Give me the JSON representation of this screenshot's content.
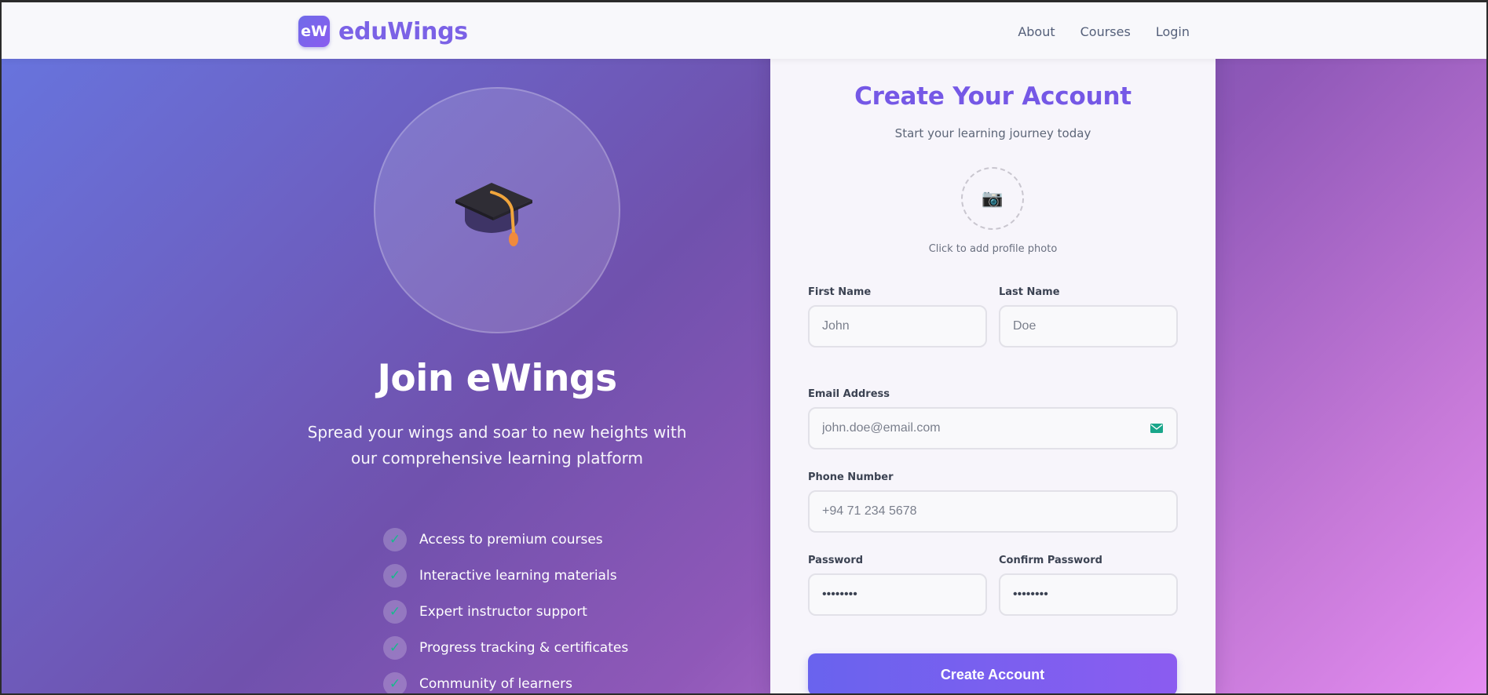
{
  "navbar": {
    "logo_mark": "eW",
    "brand_name": "eduWings",
    "links": [
      "About",
      "Courses",
      "Login"
    ]
  },
  "hero": {
    "title": "Join eWings",
    "subtitle": "Spread your wings and soar to new heights with our comprehensive learning platform",
    "features": [
      "Access to premium courses",
      "Interactive learning materials",
      "Expert instructor support",
      "Progress tracking & certificates",
      "Community of learners"
    ],
    "check_glyph": "✓"
  },
  "form": {
    "title": "Create Your Account",
    "subtitle": "Start your learning journey today",
    "photo_icon": "📷",
    "photo_hint": "Click to add profile photo",
    "first_name": {
      "label": "First Name",
      "placeholder": "John"
    },
    "last_name": {
      "label": "Last Name",
      "placeholder": "Doe"
    },
    "email": {
      "label": "Email Address",
      "placeholder": "john.doe@email.com"
    },
    "phone": {
      "label": "Phone Number",
      "placeholder": "+94 71 234 5678"
    },
    "password": {
      "label": "Password",
      "value": "••••••••"
    },
    "confirm_password": {
      "label": "Confirm Password",
      "value": "••••••••"
    },
    "submit_label": "Create Account"
  },
  "colors": {
    "accent": "#7558e6",
    "check": "#18b88d",
    "mail_icon": "#19a68a"
  },
  "icons": {
    "hero": "graduation-cap-icon",
    "photo": "camera-icon",
    "email": "envelope-icon",
    "feature": "check-icon"
  }
}
